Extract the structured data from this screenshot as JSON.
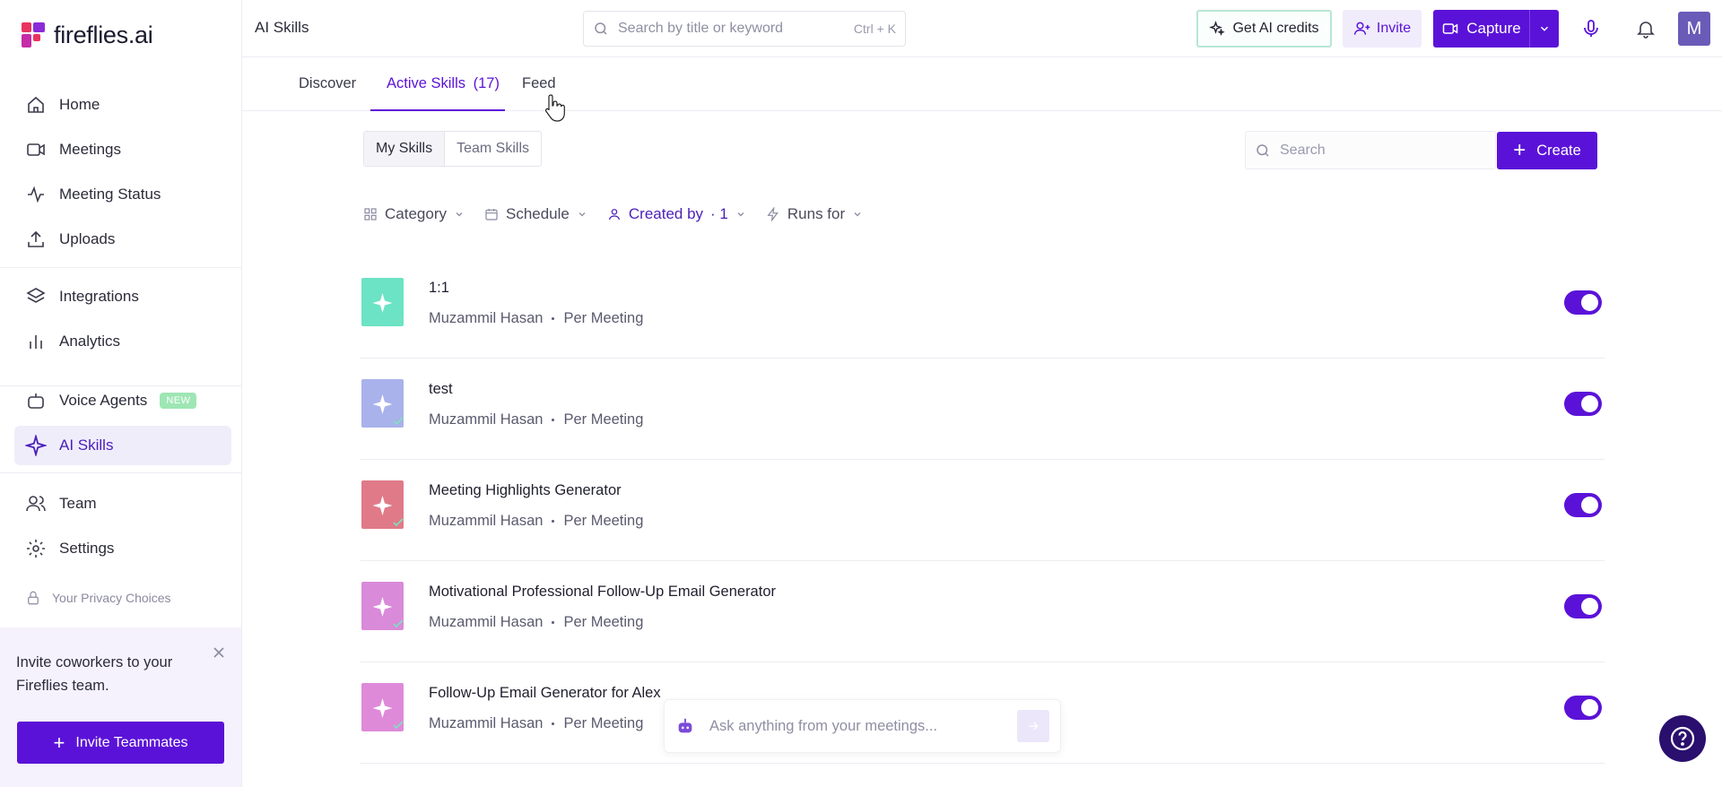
{
  "brand": {
    "name": "fireflies.ai",
    "accent": "#5b12d8"
  },
  "sidebar": {
    "items": [
      {
        "label": "Home",
        "icon": "home-icon"
      },
      {
        "label": "Meetings",
        "icon": "video-icon"
      },
      {
        "label": "Meeting Status",
        "icon": "activity-icon"
      },
      {
        "label": "Uploads",
        "icon": "upload-icon"
      },
      {
        "label": "Integrations",
        "icon": "layers-icon"
      },
      {
        "label": "Analytics",
        "icon": "bar-chart-icon"
      },
      {
        "label": "Voice Agents",
        "icon": "robot-icon",
        "badge": "NEW"
      },
      {
        "label": "AI Skills",
        "icon": "sparkle-icon",
        "active": true
      },
      {
        "label": "Team",
        "icon": "users-icon"
      },
      {
        "label": "Settings",
        "icon": "gear-icon"
      }
    ],
    "privacy": "Your Privacy Choices",
    "invite_text": "Invite coworkers to your Fireflies team.",
    "invite_button": "Invite Teammates"
  },
  "topbar": {
    "title": "AI Skills",
    "search_placeholder": "Search by title or keyword",
    "search_shortcut": "Ctrl + K",
    "credits_label": "Get AI credits",
    "invite_label": "Invite",
    "capture_label": "Capture",
    "avatar_initial": "M"
  },
  "tabs": [
    {
      "label": "Discover"
    },
    {
      "label": "Active Skills",
      "count": "(17)",
      "active": true
    },
    {
      "label": "Feed"
    }
  ],
  "segment": {
    "mine": "My Skills",
    "team": "Team Skills"
  },
  "content_search_placeholder": "Search",
  "create_label": "Create",
  "filters": {
    "category": "Category",
    "schedule": "Schedule",
    "created_by": "Created by",
    "created_by_count": "· 1",
    "runs_for": "Runs for"
  },
  "skills": [
    {
      "title": "1:1",
      "author": "Muzammil Hasan",
      "frequency": "Per Meeting",
      "color": "#6be3c4",
      "enabled": true
    },
    {
      "title": "test",
      "author": "Muzammil Hasan",
      "frequency": "Per Meeting",
      "color": "#a9b2ea",
      "enabled": true
    },
    {
      "title": "Meeting Highlights Generator",
      "author": "Muzammil Hasan",
      "frequency": "Per Meeting",
      "color": "#e07a88",
      "enabled": true
    },
    {
      "title": "Motivational Professional Follow-Up Email Generator",
      "author": "Muzammil Hasan",
      "frequency": "Per Meeting",
      "color": "#d98ad9",
      "enabled": true
    },
    {
      "title": "Follow-Up Email Generator for Alex",
      "author": "Muzammil Hasan",
      "frequency": "Per Meeting",
      "color": "#de8ad9",
      "enabled": true
    }
  ],
  "ask": {
    "placeholder": "Ask anything from your meetings..."
  }
}
